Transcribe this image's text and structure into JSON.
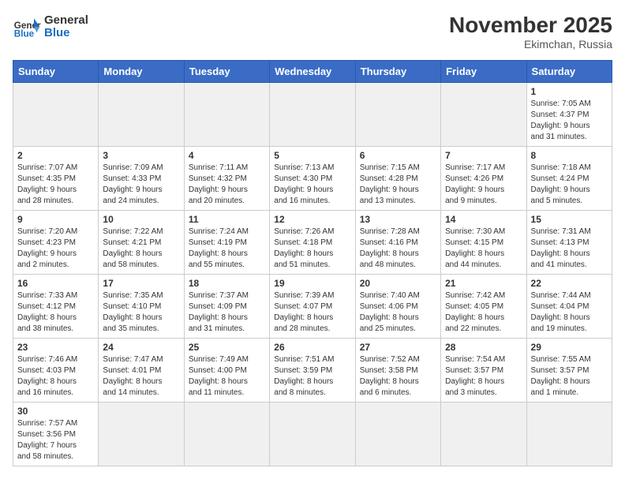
{
  "header": {
    "logo_text_general": "General",
    "logo_text_blue": "Blue",
    "month_title": "November 2025",
    "location": "Ekimchan, Russia"
  },
  "days_of_week": [
    "Sunday",
    "Monday",
    "Tuesday",
    "Wednesday",
    "Thursday",
    "Friday",
    "Saturday"
  ],
  "weeks": [
    [
      {
        "day": "",
        "info": ""
      },
      {
        "day": "",
        "info": ""
      },
      {
        "day": "",
        "info": ""
      },
      {
        "day": "",
        "info": ""
      },
      {
        "day": "",
        "info": ""
      },
      {
        "day": "",
        "info": ""
      },
      {
        "day": "1",
        "info": "Sunrise: 7:05 AM\nSunset: 4:37 PM\nDaylight: 9 hours\nand 31 minutes."
      }
    ],
    [
      {
        "day": "2",
        "info": "Sunrise: 7:07 AM\nSunset: 4:35 PM\nDaylight: 9 hours\nand 28 minutes."
      },
      {
        "day": "3",
        "info": "Sunrise: 7:09 AM\nSunset: 4:33 PM\nDaylight: 9 hours\nand 24 minutes."
      },
      {
        "day": "4",
        "info": "Sunrise: 7:11 AM\nSunset: 4:32 PM\nDaylight: 9 hours\nand 20 minutes."
      },
      {
        "day": "5",
        "info": "Sunrise: 7:13 AM\nSunset: 4:30 PM\nDaylight: 9 hours\nand 16 minutes."
      },
      {
        "day": "6",
        "info": "Sunrise: 7:15 AM\nSunset: 4:28 PM\nDaylight: 9 hours\nand 13 minutes."
      },
      {
        "day": "7",
        "info": "Sunrise: 7:17 AM\nSunset: 4:26 PM\nDaylight: 9 hours\nand 9 minutes."
      },
      {
        "day": "8",
        "info": "Sunrise: 7:18 AM\nSunset: 4:24 PM\nDaylight: 9 hours\nand 5 minutes."
      }
    ],
    [
      {
        "day": "9",
        "info": "Sunrise: 7:20 AM\nSunset: 4:23 PM\nDaylight: 9 hours\nand 2 minutes."
      },
      {
        "day": "10",
        "info": "Sunrise: 7:22 AM\nSunset: 4:21 PM\nDaylight: 8 hours\nand 58 minutes."
      },
      {
        "day": "11",
        "info": "Sunrise: 7:24 AM\nSunset: 4:19 PM\nDaylight: 8 hours\nand 55 minutes."
      },
      {
        "day": "12",
        "info": "Sunrise: 7:26 AM\nSunset: 4:18 PM\nDaylight: 8 hours\nand 51 minutes."
      },
      {
        "day": "13",
        "info": "Sunrise: 7:28 AM\nSunset: 4:16 PM\nDaylight: 8 hours\nand 48 minutes."
      },
      {
        "day": "14",
        "info": "Sunrise: 7:30 AM\nSunset: 4:15 PM\nDaylight: 8 hours\nand 44 minutes."
      },
      {
        "day": "15",
        "info": "Sunrise: 7:31 AM\nSunset: 4:13 PM\nDaylight: 8 hours\nand 41 minutes."
      }
    ],
    [
      {
        "day": "16",
        "info": "Sunrise: 7:33 AM\nSunset: 4:12 PM\nDaylight: 8 hours\nand 38 minutes."
      },
      {
        "day": "17",
        "info": "Sunrise: 7:35 AM\nSunset: 4:10 PM\nDaylight: 8 hours\nand 35 minutes."
      },
      {
        "day": "18",
        "info": "Sunrise: 7:37 AM\nSunset: 4:09 PM\nDaylight: 8 hours\nand 31 minutes."
      },
      {
        "day": "19",
        "info": "Sunrise: 7:39 AM\nSunset: 4:07 PM\nDaylight: 8 hours\nand 28 minutes."
      },
      {
        "day": "20",
        "info": "Sunrise: 7:40 AM\nSunset: 4:06 PM\nDaylight: 8 hours\nand 25 minutes."
      },
      {
        "day": "21",
        "info": "Sunrise: 7:42 AM\nSunset: 4:05 PM\nDaylight: 8 hours\nand 22 minutes."
      },
      {
        "day": "22",
        "info": "Sunrise: 7:44 AM\nSunset: 4:04 PM\nDaylight: 8 hours\nand 19 minutes."
      }
    ],
    [
      {
        "day": "23",
        "info": "Sunrise: 7:46 AM\nSunset: 4:03 PM\nDaylight: 8 hours\nand 16 minutes."
      },
      {
        "day": "24",
        "info": "Sunrise: 7:47 AM\nSunset: 4:01 PM\nDaylight: 8 hours\nand 14 minutes."
      },
      {
        "day": "25",
        "info": "Sunrise: 7:49 AM\nSunset: 4:00 PM\nDaylight: 8 hours\nand 11 minutes."
      },
      {
        "day": "26",
        "info": "Sunrise: 7:51 AM\nSunset: 3:59 PM\nDaylight: 8 hours\nand 8 minutes."
      },
      {
        "day": "27",
        "info": "Sunrise: 7:52 AM\nSunset: 3:58 PM\nDaylight: 8 hours\nand 6 minutes."
      },
      {
        "day": "28",
        "info": "Sunrise: 7:54 AM\nSunset: 3:57 PM\nDaylight: 8 hours\nand 3 minutes."
      },
      {
        "day": "29",
        "info": "Sunrise: 7:55 AM\nSunset: 3:57 PM\nDaylight: 8 hours\nand 1 minute."
      }
    ],
    [
      {
        "day": "30",
        "info": "Sunrise: 7:57 AM\nSunset: 3:56 PM\nDaylight: 7 hours\nand 58 minutes."
      },
      {
        "day": "",
        "info": ""
      },
      {
        "day": "",
        "info": ""
      },
      {
        "day": "",
        "info": ""
      },
      {
        "day": "",
        "info": ""
      },
      {
        "day": "",
        "info": ""
      },
      {
        "day": "",
        "info": ""
      }
    ]
  ]
}
